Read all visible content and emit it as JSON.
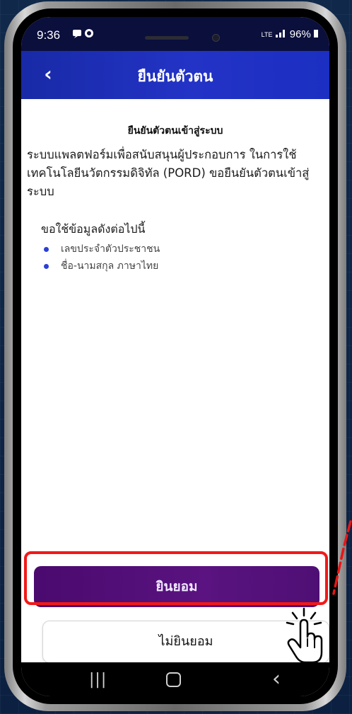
{
  "status_bar": {
    "time": "9:36",
    "battery": "96%",
    "network": "LTE"
  },
  "header": {
    "title": "ยืนยันตัวตน",
    "back_label": "‹"
  },
  "content": {
    "heading": "ยืนยันตัวตนเข้าสู่ระบบ",
    "paragraph": "ระบบแพลตฟอร์มเพื่อสนับสนุนผู้ประกอบการ ในการใช้เทคโนโลยีนวัตกรรมดิจิทัล (PORD) ขอยืนยันตัวตนเข้าสู่ระบบ",
    "requirements_title": "ขอใช้ข้อมูลดังต่อไปนี้",
    "requirements": [
      "เลขประจำตัวประชาชน",
      "ชื่อ-นามสกุล ภาษาไทย"
    ]
  },
  "buttons": {
    "accept": "ยินยอม",
    "decline": "ไม่ยินยอม"
  },
  "colors": {
    "header_blue": "#2333c6",
    "accept_purple": "#5a1380",
    "highlight_red": "#f21818",
    "bullet_blue": "#2a3fd6"
  },
  "icons": [
    "back-chevron-icon",
    "recent-apps-icon",
    "home-icon",
    "nav-back-icon",
    "pointer-hand-icon"
  ]
}
